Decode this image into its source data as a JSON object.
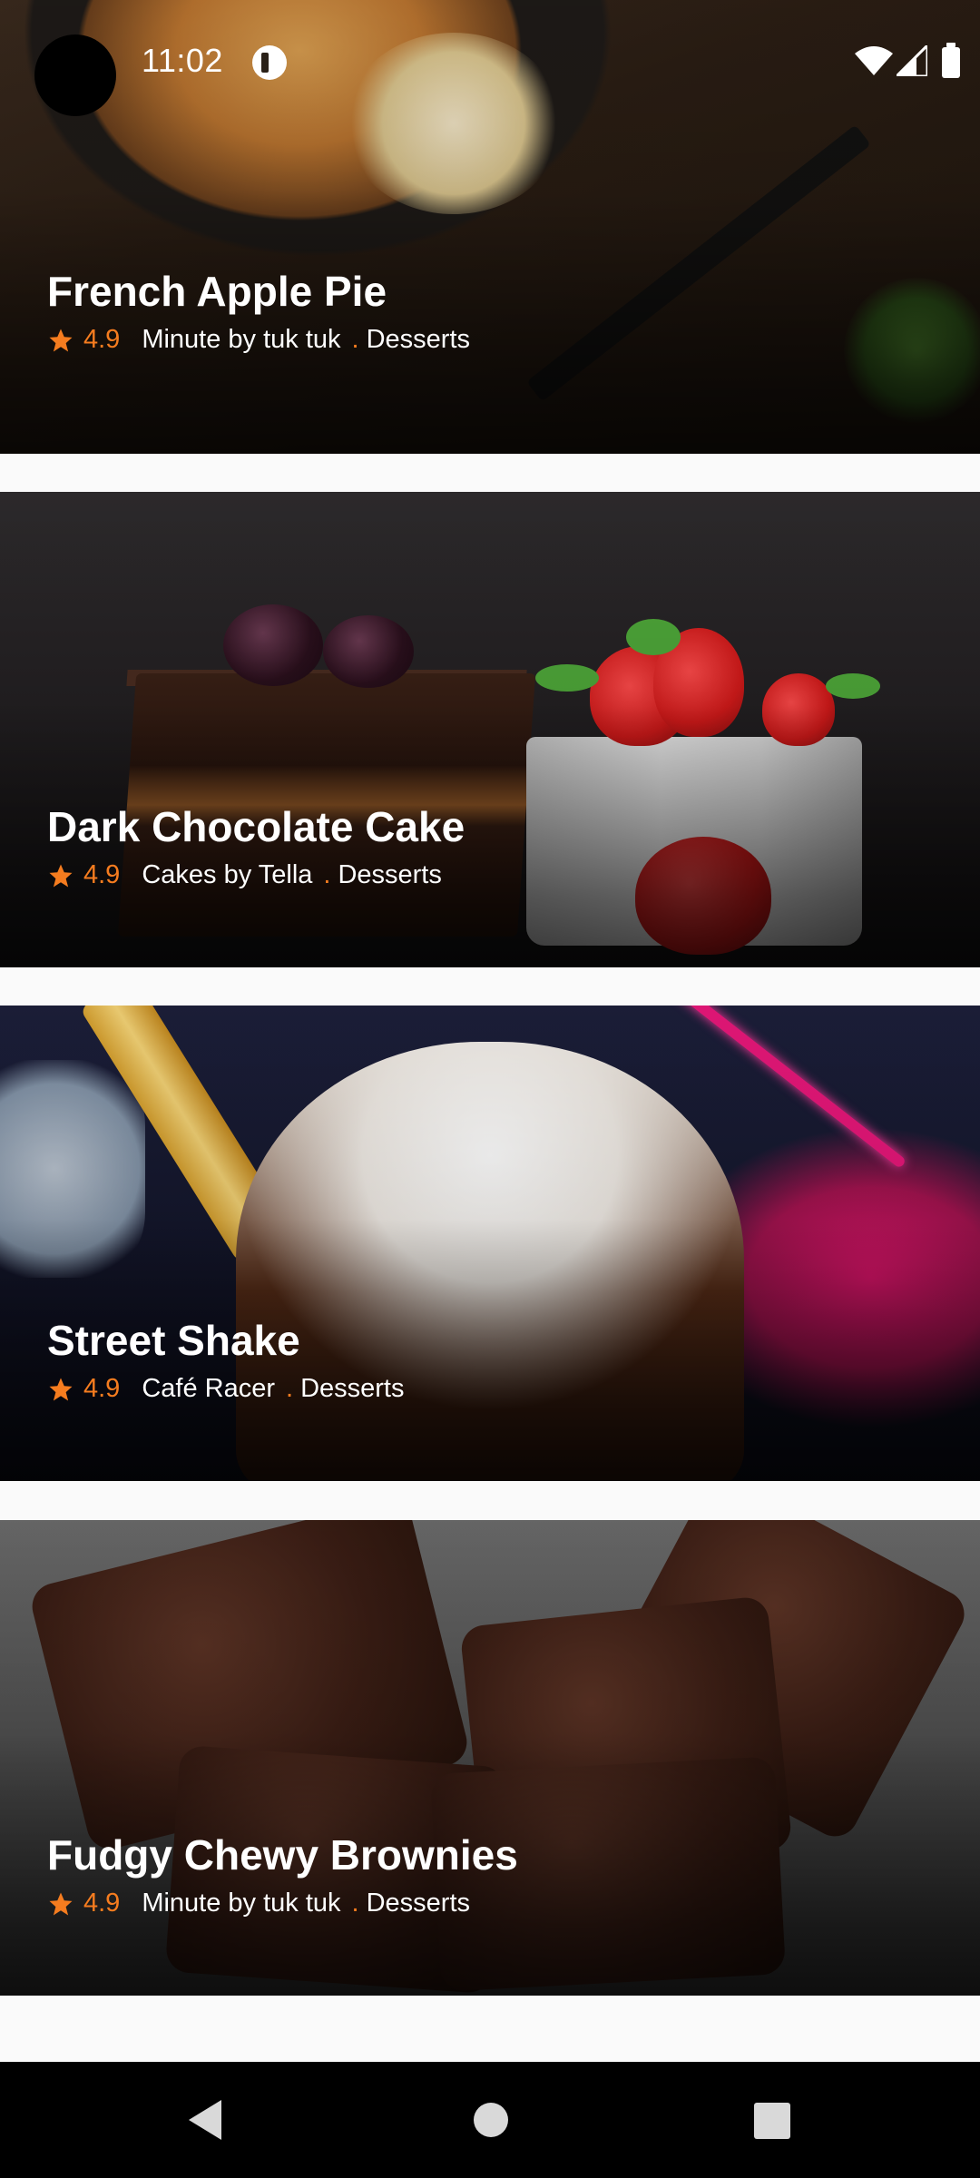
{
  "status_bar": {
    "time": "11:02",
    "icons": [
      "notification-icon",
      "wifi-icon",
      "signal-icon",
      "battery-icon"
    ]
  },
  "accent_color": "#f57c1f",
  "recipes": [
    {
      "title": "French Apple Pie",
      "rating": "4.9",
      "source": "Minute by tuk tuk",
      "separator": ".",
      "category": "Desserts"
    },
    {
      "title": "Dark Chocolate Cake",
      "rating": "4.9",
      "source": "Cakes by Tella",
      "separator": ".",
      "category": "Desserts"
    },
    {
      "title": "Street Shake",
      "rating": "4.9",
      "source": "Café Racer",
      "separator": ".",
      "category": "Desserts"
    },
    {
      "title": "Fudgy Chewy Brownies",
      "rating": "4.9",
      "source": "Minute by tuk tuk",
      "separator": ".",
      "category": "Desserts"
    }
  ],
  "nav_bar": {
    "buttons": [
      "back-icon",
      "home-icon",
      "recents-icon"
    ]
  }
}
